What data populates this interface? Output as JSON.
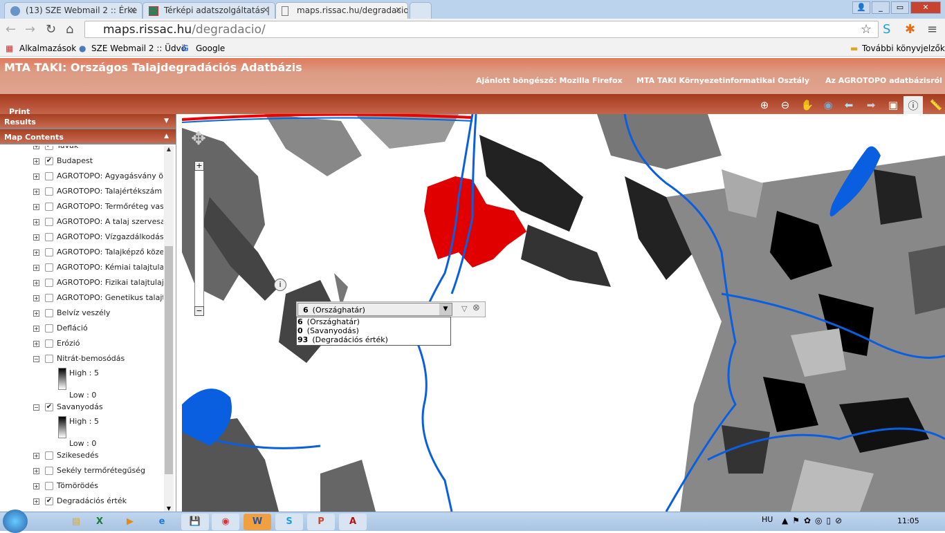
{
  "browser": {
    "tabs": [
      {
        "label": "(13) SZE Webmail 2 :: Érke",
        "icon": "webmail-icon"
      },
      {
        "label": "Térképi adatszolgáltatás |",
        "icon": "map-service-icon"
      },
      {
        "label": "maps.rissac.hu/degradacio",
        "icon": "page-icon",
        "active": true
      }
    ],
    "url_host": "maps.rissac.hu",
    "url_path": "/degradacio/",
    "bookmarks": [
      "Alkalmazások",
      "SZE Webmail 2 :: Üdvö",
      "Google"
    ],
    "other_bookmarks": "További könyvjelzők"
  },
  "header": {
    "title": "MTA TAKI: Országos Talajdegradációs Adatbázis",
    "links": [
      "Ajánlott böngésző: Mozilla Firefox",
      "MTA TAKI Környezetinformatikai Osztály",
      "Az AGROTOPO adatbázisról"
    ]
  },
  "toolbar": {
    "print": "Print",
    "tools": [
      "zoom-in-icon",
      "zoom-out-icon",
      "pan-icon",
      "full-extent-icon",
      "back-icon",
      "forward-icon",
      "zoom-box-icon",
      "identify-icon",
      "measure-icon"
    ]
  },
  "panel": {
    "results": "Results",
    "map_contents": "Map Contents",
    "layers": [
      {
        "label": "Tavak",
        "checked": true
      },
      {
        "label": "Budapest",
        "checked": true
      },
      {
        "label": "AGROTOPO: Agyagásvány ös",
        "checked": false
      },
      {
        "label": "AGROTOPO: Talajértékszám",
        "checked": false
      },
      {
        "label": "AGROTOPO: Termőréteg vast",
        "checked": false
      },
      {
        "label": "AGROTOPO: A talaj szervesa",
        "checked": false
      },
      {
        "label": "AGROTOPO: Vízgazdálkodási",
        "checked": false
      },
      {
        "label": "AGROTOPO: Talajképző köze",
        "checked": false
      },
      {
        "label": "AGROTOPO: Kémiai talajtulaj",
        "checked": false
      },
      {
        "label": "AGROTOPO: Fizikai talajtulaj",
        "checked": false
      },
      {
        "label": "AGROTOPO: Genetikus talajt",
        "checked": false
      },
      {
        "label": "Belvíz veszély",
        "checked": false
      },
      {
        "label": "Defláció",
        "checked": false
      },
      {
        "label": "Erózió",
        "checked": false
      },
      {
        "label": "Nitrát-bemosódás",
        "checked": false,
        "expanded": true,
        "legend": {
          "high": "High : 5",
          "low": "Low : 0"
        }
      },
      {
        "label": "Savanyodás",
        "checked": true,
        "expanded": true,
        "legend": {
          "high": "High : 5",
          "low": "Low : 0"
        }
      },
      {
        "label": "Szikesedés",
        "checked": false
      },
      {
        "label": "Sekély termőrétegűség",
        "checked": false
      },
      {
        "label": "Tömörödés",
        "checked": false
      },
      {
        "label": "Degradációs érték",
        "checked": true
      }
    ]
  },
  "identify": {
    "selected": {
      "value": "6",
      "label": "(Országhatár)"
    },
    "items": [
      {
        "value": "6",
        "label": "(Országhatár)"
      },
      {
        "value": "0",
        "label": "(Savanyodás)"
      },
      {
        "value": "93",
        "label": "(Degradációs érték)"
      }
    ]
  },
  "colors": {
    "budapest": "#e00000",
    "water": "#0a5fe0",
    "header": "#c0573a"
  },
  "taskbar": {
    "lang": "HU",
    "time": "11:05",
    "apps": [
      "excel-icon",
      "media-icon",
      "ie-icon",
      "save-icon",
      "chrome-icon",
      "word-icon",
      "skype-icon",
      "powerpoint-icon",
      "acrobat-icon"
    ]
  }
}
